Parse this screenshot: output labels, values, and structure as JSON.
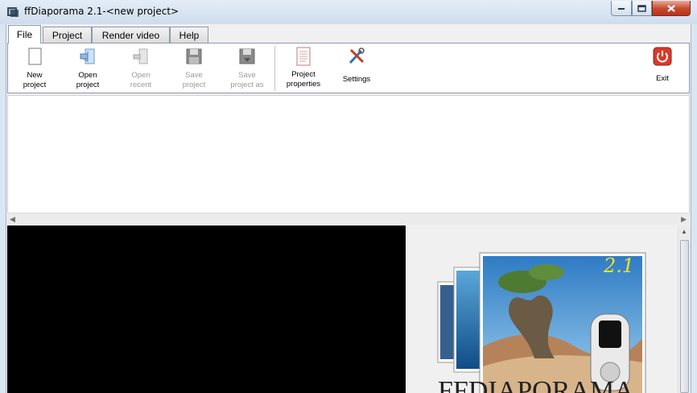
{
  "window": {
    "title": "ffDiaporama 2.1-<new project>"
  },
  "tabs": [
    {
      "label": "File",
      "active": true
    },
    {
      "label": "Project"
    },
    {
      "label": "Render video"
    },
    {
      "label": "Help"
    }
  ],
  "ribbon": {
    "new_project": {
      "line1": "New",
      "line2": "project"
    },
    "open_project": {
      "line1": "Open",
      "line2": "project"
    },
    "open_recent": {
      "line1": "Open",
      "line2": "recent"
    },
    "save_project": {
      "line1": "Save",
      "line2": "project"
    },
    "save_project_as": {
      "line1": "Save",
      "line2": "project as"
    },
    "project_properties": {
      "line1": "Project",
      "line2": "properties"
    },
    "settings": {
      "label": "Settings"
    },
    "exit": {
      "label": "Exit"
    }
  },
  "splash": {
    "version": "2.1",
    "brand": "FFDIAPORAMA"
  },
  "colors": {
    "accent": "#c9462c",
    "preview_bg": "#000000",
    "version_text": "#f5e21a"
  }
}
